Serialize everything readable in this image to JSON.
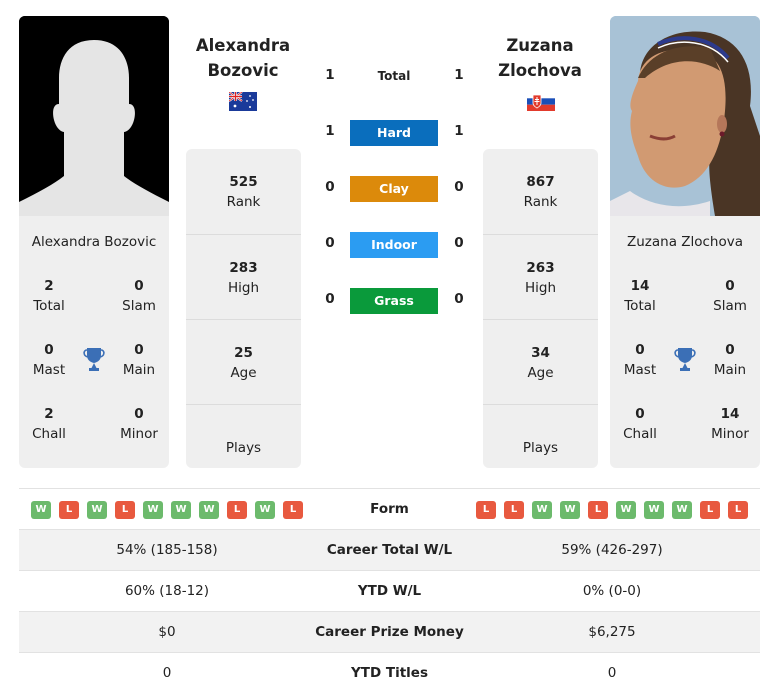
{
  "colors": {
    "hard": "#0a6ebd",
    "clay": "#dc8a0b",
    "indoor": "#2b9cf2",
    "grass": "#0a9a3b",
    "win": "#6cba6c",
    "loss": "#e8593f",
    "trophy": "#3b6fb6"
  },
  "player_left": {
    "name_line1": "Alexandra",
    "name_line2": "Bozovic",
    "full_name": "Alexandra Bozovic",
    "flag": "australia-flag",
    "photo": "silhouette-placeholder",
    "titles": {
      "total": "2",
      "total_label": "Total",
      "slam": "0",
      "slam_label": "Slam",
      "mast": "0",
      "mast_label": "Mast",
      "main": "0",
      "main_label": "Main",
      "chall": "2",
      "chall_label": "Chall",
      "minor": "0",
      "minor_label": "Minor"
    },
    "rank": "525",
    "rank_label": "Rank",
    "high": "283",
    "high_label": "High",
    "age": "25",
    "age_label": "Age",
    "plays_label": "Plays",
    "form": [
      "W",
      "L",
      "W",
      "L",
      "W",
      "W",
      "W",
      "L",
      "W",
      "L"
    ],
    "career_wl": "54% (185-158)",
    "ytd_wl": "60% (18-12)",
    "prize_money": "$0",
    "ytd_titles": "0"
  },
  "player_right": {
    "name_line1": "Zuzana",
    "name_line2": "Zlochova",
    "full_name": "Zuzana Zlochova",
    "flag": "slovakia-flag",
    "photo": "player-photo",
    "titles": {
      "total": "14",
      "total_label": "Total",
      "slam": "0",
      "slam_label": "Slam",
      "mast": "0",
      "mast_label": "Mast",
      "main": "0",
      "main_label": "Main",
      "chall": "0",
      "chall_label": "Chall",
      "minor": "14",
      "minor_label": "Minor"
    },
    "rank": "867",
    "rank_label": "Rank",
    "high": "263",
    "high_label": "High",
    "age": "34",
    "age_label": "Age",
    "plays_label": "Plays",
    "form": [
      "L",
      "L",
      "W",
      "W",
      "L",
      "W",
      "W",
      "W",
      "L",
      "L"
    ],
    "career_wl": "59% (426-297)",
    "ytd_wl": "0% (0-0)",
    "prize_money": "$6,275",
    "ytd_titles": "0"
  },
  "h2h": {
    "total": {
      "label": "Total",
      "left": "1",
      "right": "1"
    },
    "hard": {
      "label": "Hard",
      "left": "1",
      "right": "1"
    },
    "clay": {
      "label": "Clay",
      "left": "0",
      "right": "0"
    },
    "indoor": {
      "label": "Indoor",
      "left": "0",
      "right": "0"
    },
    "grass": {
      "label": "Grass",
      "left": "0",
      "right": "0"
    }
  },
  "table": {
    "form_label": "Form",
    "career_wl_label": "Career Total W/L",
    "ytd_wl_label": "YTD W/L",
    "prize_label": "Career Prize Money",
    "ytd_titles_label": "YTD Titles"
  }
}
